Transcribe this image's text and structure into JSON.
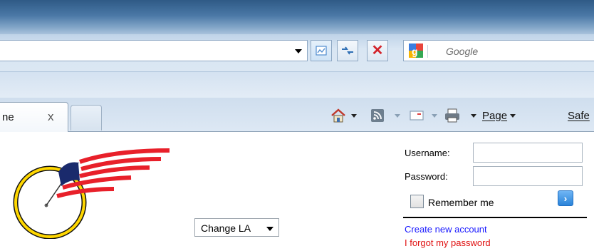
{
  "browser": {
    "search_placeholder": "Google",
    "tab": {
      "title": "ne",
      "close": "x"
    },
    "commands": {
      "page_label": "Page",
      "safety_label": "Safe"
    }
  },
  "page": {
    "change_select": {
      "selected": "Change LA"
    },
    "login": {
      "username_label": "Username:",
      "password_label": "Password:",
      "remember_label": "Remember me",
      "go_glyph": "›",
      "create_account_link": "Create new account",
      "forgot_password_link": "I forgot my password"
    }
  },
  "colors": {
    "link_blue": "#1a1aff",
    "link_red": "#e01010",
    "stop_red": "#d3232a",
    "logo_yellow": "#ffd700",
    "flag_red": "#e8202a",
    "flag_blue": "#1a2a6c"
  },
  "icons": [
    "compatibility-view-icon",
    "refresh-icon",
    "stop-icon",
    "google-icon",
    "home-icon",
    "feeds-icon",
    "mail-icon",
    "print-icon"
  ]
}
